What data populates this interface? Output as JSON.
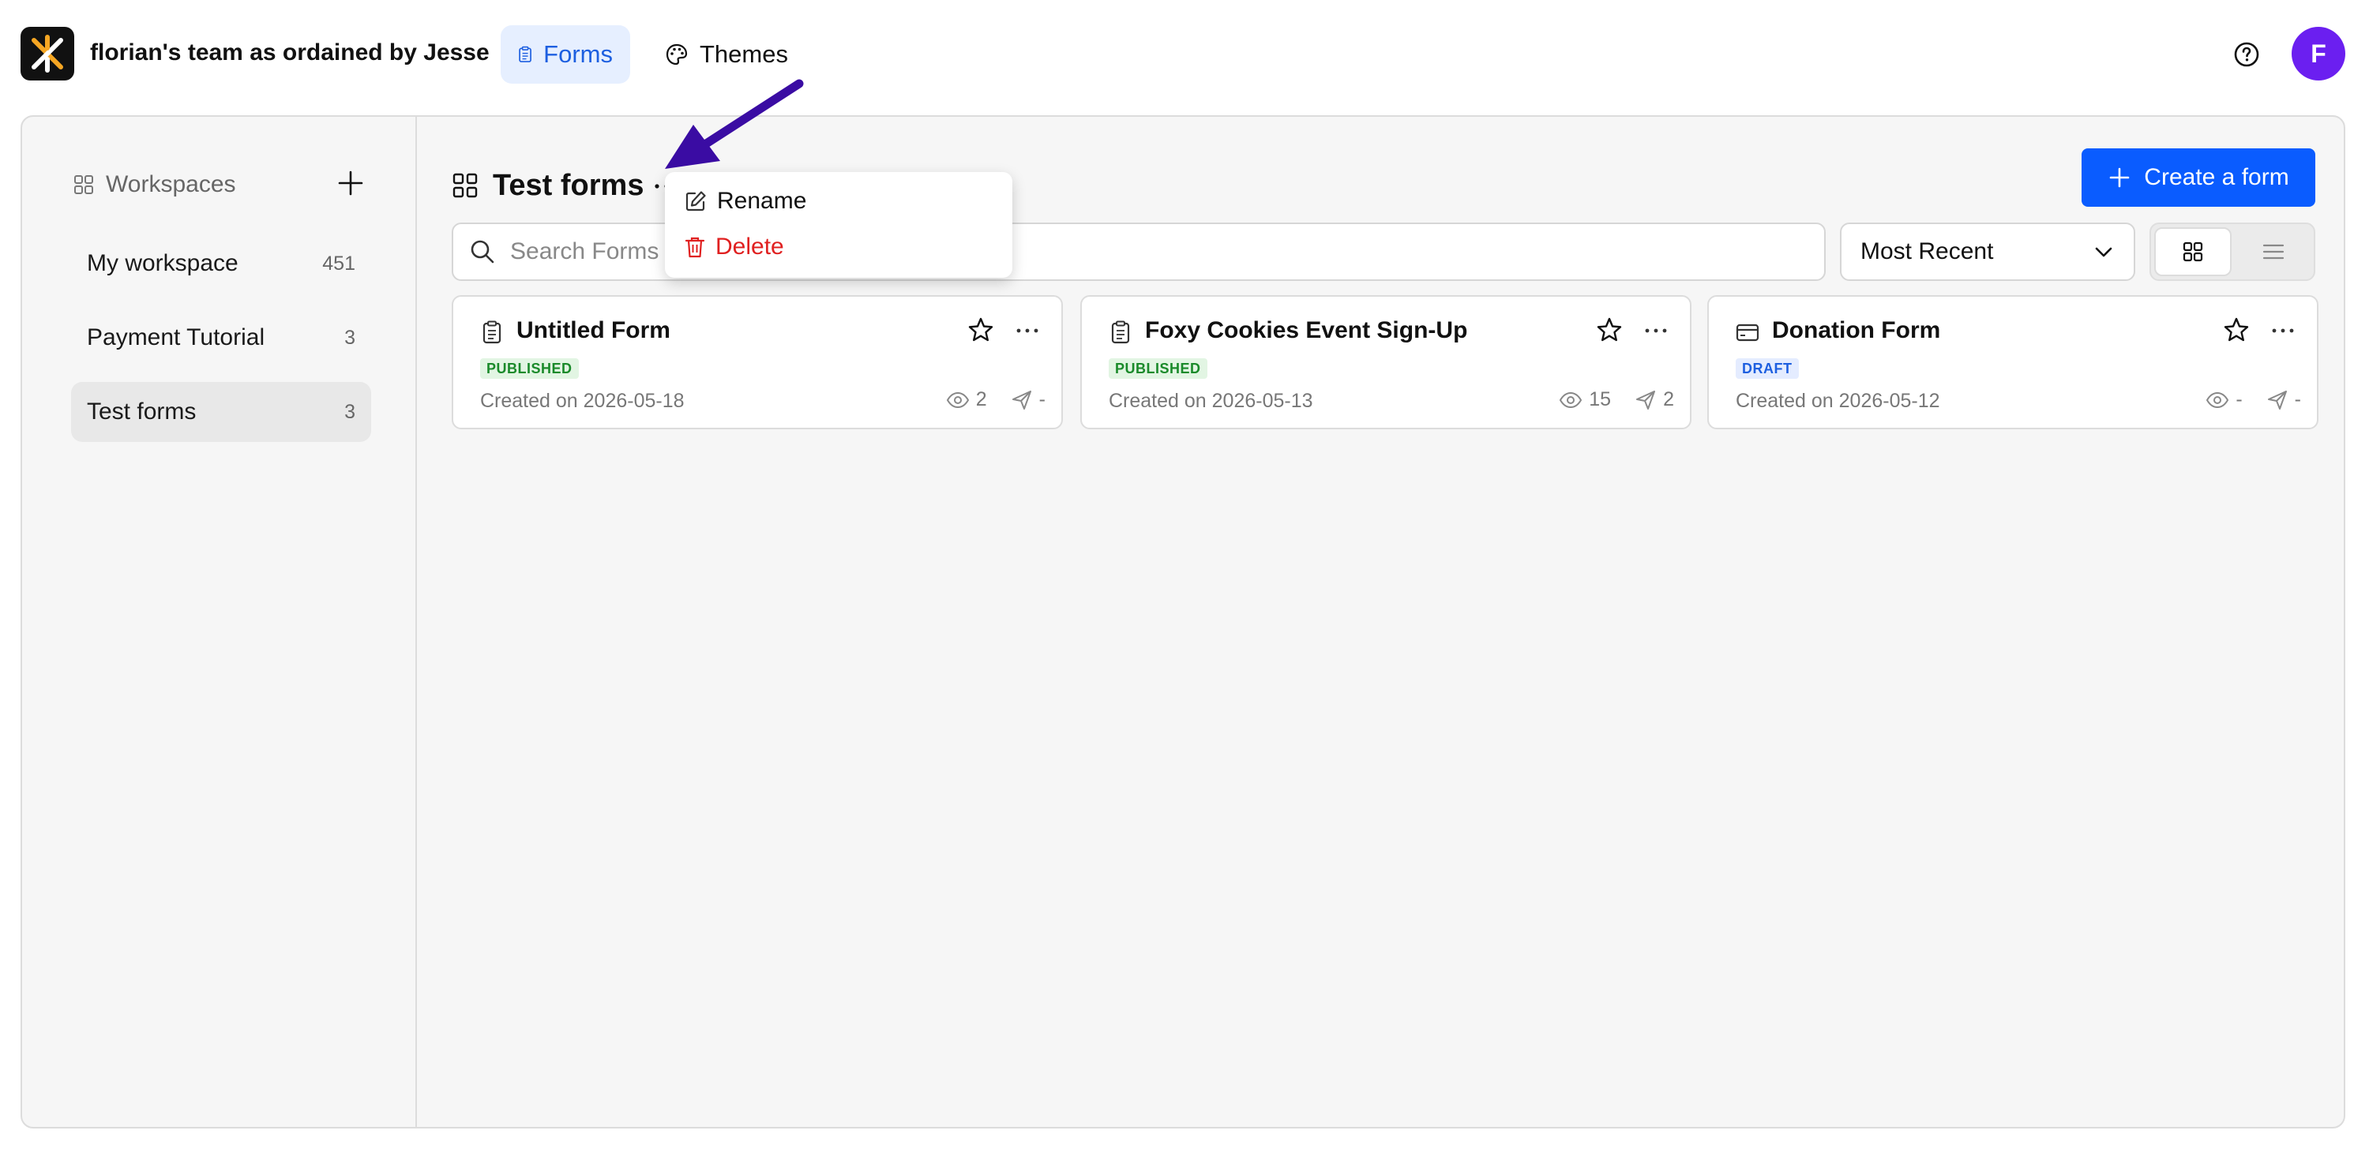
{
  "header": {
    "team_name": "florian's team as ordained by Jesse",
    "tabs": [
      {
        "label": "Forms",
        "active": true
      },
      {
        "label": "Themes",
        "active": false
      }
    ],
    "avatar_initial": "F"
  },
  "sidebar": {
    "workspaces_label": "Workspaces",
    "items": [
      {
        "label": "My workspace",
        "count": "451",
        "active": false
      },
      {
        "label": "Payment Tutorial",
        "count": "3",
        "active": false
      },
      {
        "label": "Test forms",
        "count": "3",
        "active": true
      }
    ]
  },
  "main": {
    "title": "Test forms",
    "create_label": "Create a form",
    "search_placeholder": "Search Forms",
    "sort_value": "Most Recent",
    "forms": [
      {
        "title": "Untitled Form",
        "status": "PUBLISHED",
        "created": "Created on 2026-05-18",
        "views": "2",
        "responses": "-"
      },
      {
        "title": "Foxy Cookies Event Sign-Up",
        "status": "PUBLISHED",
        "created": "Created on 2026-05-13",
        "views": "15",
        "responses": "2"
      },
      {
        "title": "Donation Form",
        "status": "DRAFT",
        "created": "Created on 2026-05-12",
        "views": "-",
        "responses": "-"
      }
    ]
  },
  "context_menu": {
    "rename_label": "Rename",
    "delete_label": "Delete"
  },
  "colors": {
    "accent": "#0a5cff",
    "avatar": "#6b1ff0",
    "danger": "#e02020",
    "arrow": "#3a0ca3"
  }
}
